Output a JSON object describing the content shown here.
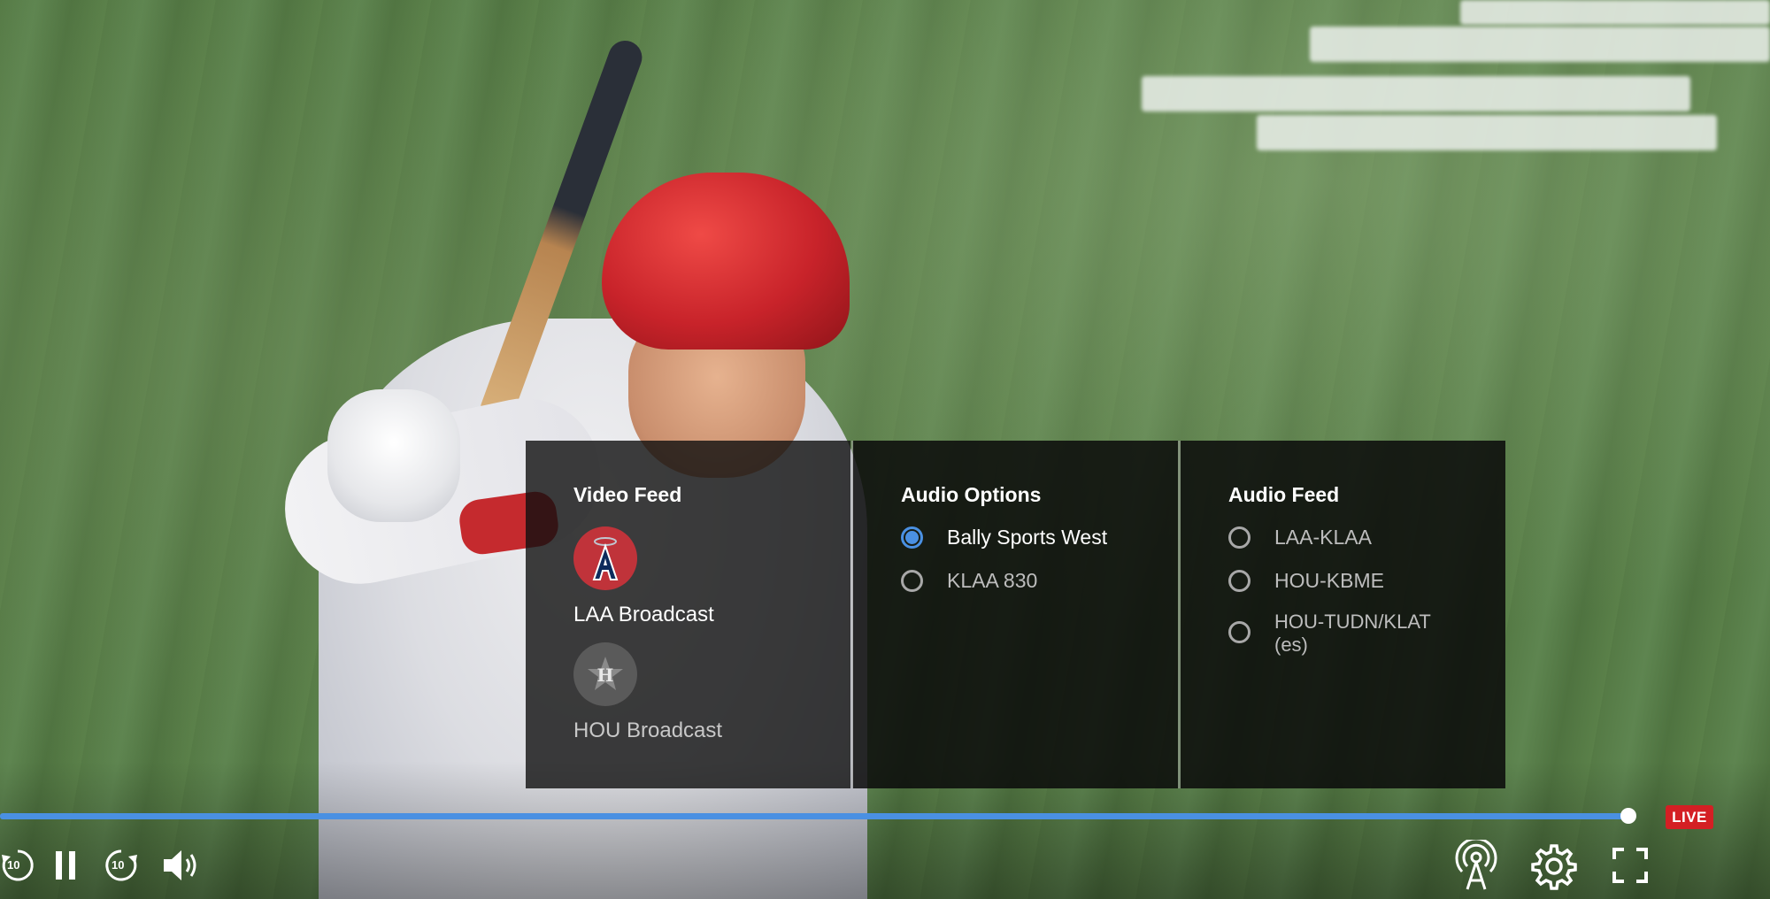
{
  "player": {
    "live_badge": "LIVE",
    "progress_fraction": 0.92,
    "seek_back_seconds": "10",
    "seek_forward_seconds": "10",
    "accent_color": "#4a90e2",
    "live_color": "#d41f24"
  },
  "video_feed": {
    "title": "Video Feed",
    "feeds": [
      {
        "label": "LAA Broadcast",
        "icon": "angels-logo-icon",
        "selected": true
      },
      {
        "label": "HOU Broadcast",
        "icon": "astros-logo-icon",
        "selected": false
      }
    ]
  },
  "audio_options": {
    "title": "Audio Options",
    "options": [
      {
        "label": "Bally Sports West",
        "selected": true
      },
      {
        "label": "KLAA 830",
        "selected": false
      }
    ]
  },
  "audio_feed": {
    "title": "Audio Feed",
    "options": [
      {
        "label": "LAA-KLAA",
        "selected": false
      },
      {
        "label": "HOU-KBME",
        "selected": false
      },
      {
        "label": "HOU-TUDN/KLAT\n(es)",
        "selected": false
      }
    ]
  },
  "toolbar_icons": [
    "rewind-10-icon",
    "pause-icon",
    "forward-10-icon",
    "volume-icon",
    "airplay-icon",
    "settings-gear-icon",
    "fullscreen-icon"
  ]
}
